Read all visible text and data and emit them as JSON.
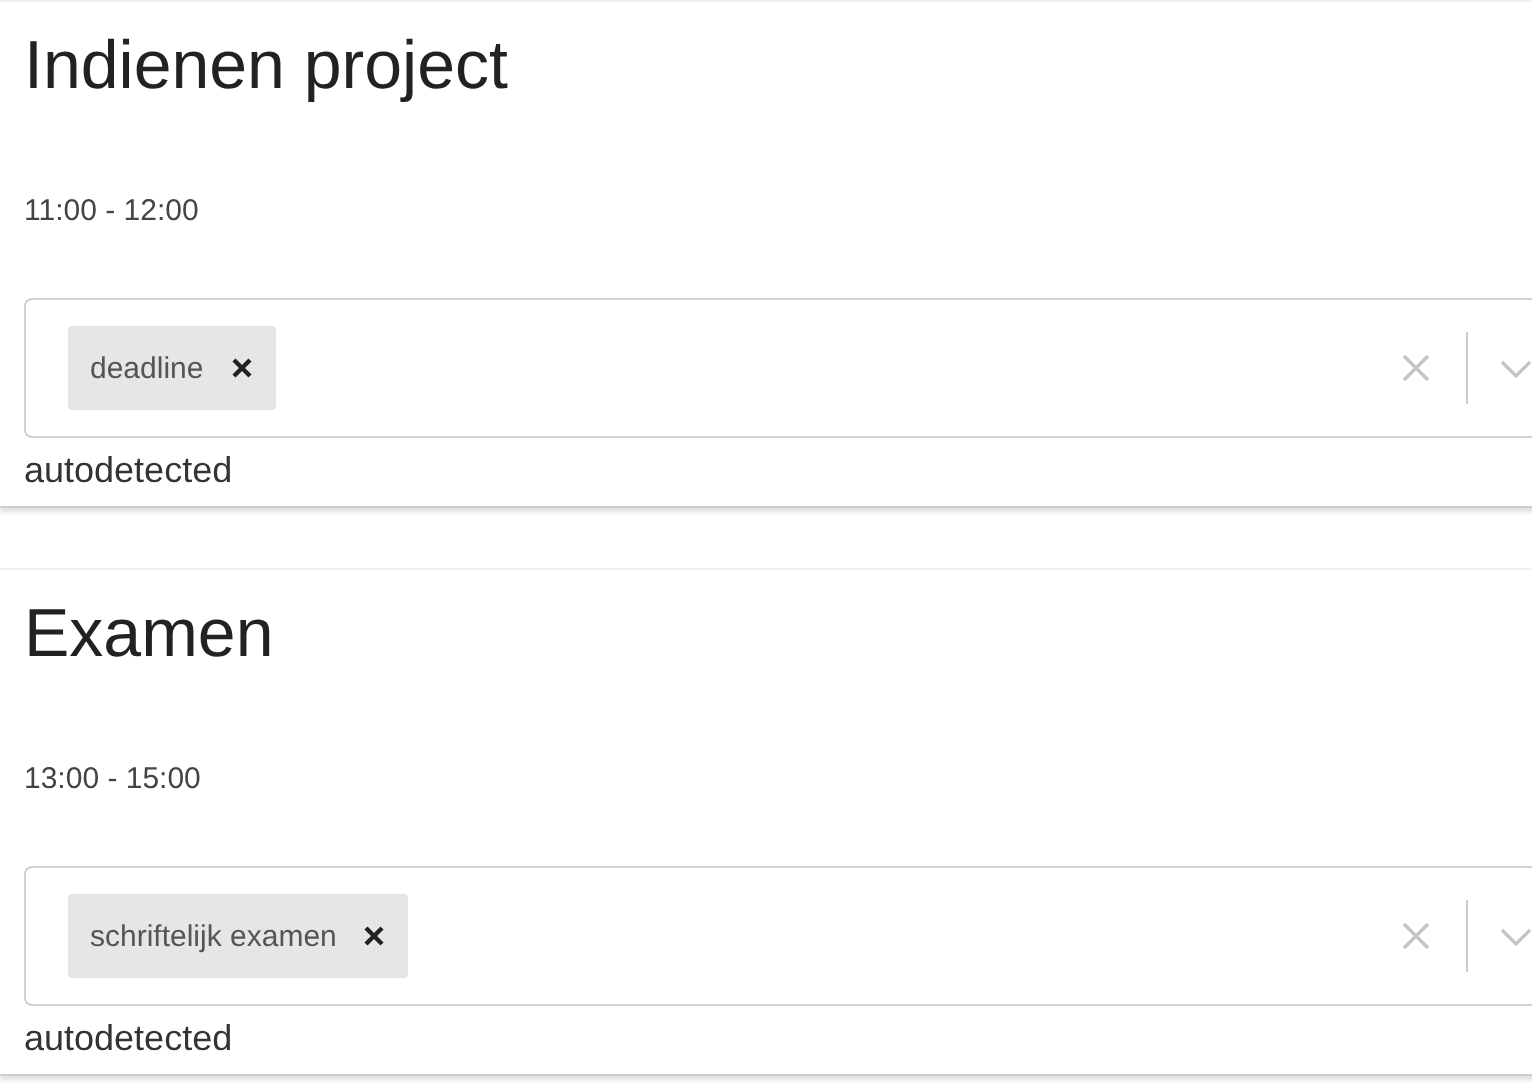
{
  "events": [
    {
      "title": "Indienen project",
      "time": "11:00 - 12:00",
      "tags": [
        {
          "label": "deadline"
        }
      ],
      "note": "autodetected"
    },
    {
      "title": "Examen",
      "time": "13:00 - 15:00",
      "tags": [
        {
          "label": "schriftelijk examen"
        }
      ],
      "note": "autodetected"
    }
  ]
}
